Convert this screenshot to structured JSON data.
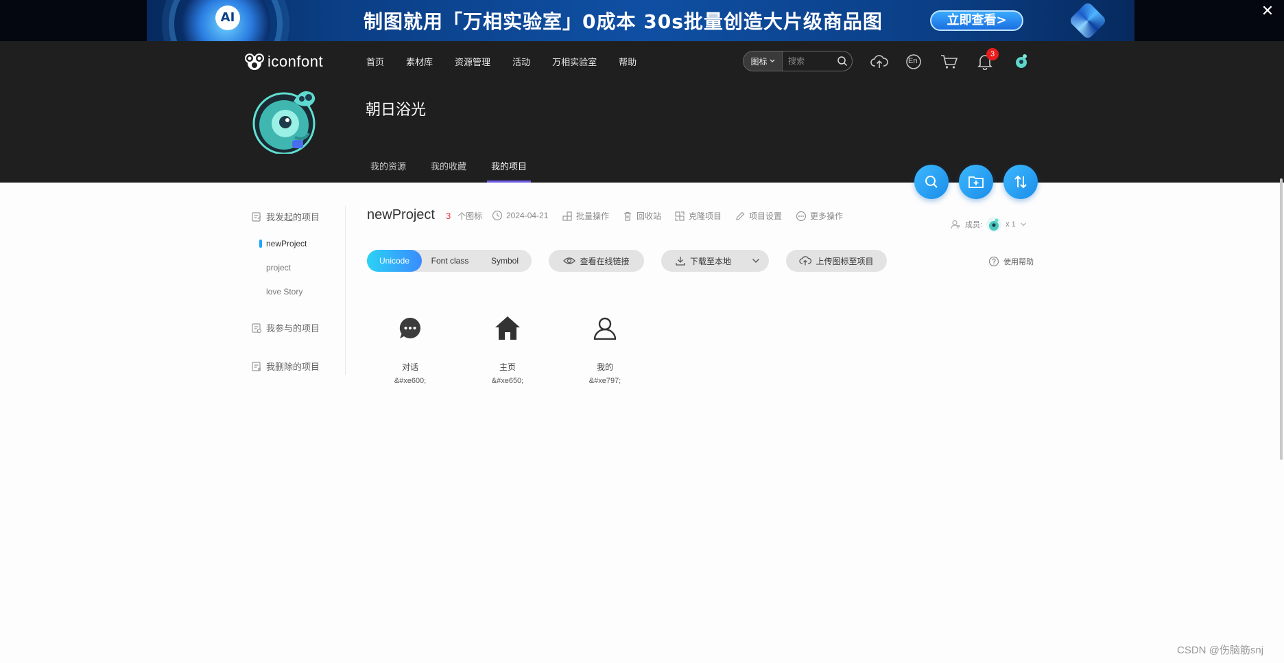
{
  "promo": {
    "ai_badge": "AI",
    "text": "制图就用「万相实验室」0成本 30s批量创造大片级商品图",
    "button": "立即查看>",
    "close": "✕"
  },
  "header": {
    "logo_text": "iconfont",
    "nav": [
      "首页",
      "素材库",
      "资源管理",
      "活动",
      "万相实验室",
      "帮助"
    ],
    "search": {
      "type_label": "图标",
      "placeholder": "搜索"
    },
    "language_label": "En",
    "notification_count": "3"
  },
  "profile": {
    "name": "朝日浴光",
    "tabs": [
      "我的资源",
      "我的收藏",
      "我的项目"
    ],
    "active_tab": "我的项目"
  },
  "sidebar": {
    "group_created": "我发起的项目",
    "projects": [
      "newProject",
      "project",
      "love Story"
    ],
    "active_project": "newProject",
    "group_joined": "我参与的项目",
    "group_deleted": "我删除的项目"
  },
  "project": {
    "name": "newProject",
    "icon_count": "3",
    "icon_count_label": "个图标",
    "date": "2024-04-21",
    "actions": {
      "batch": "批量操作",
      "recycle": "回收站",
      "clone": "克隆项目",
      "settings": "项目设置",
      "more": "更多操作"
    },
    "members_label": "成员:",
    "members_count": "x 1"
  },
  "toolbar": {
    "formats": [
      "Unicode",
      "Font class",
      "Symbol"
    ],
    "active_format": "Unicode",
    "view_online": "查看在线链接",
    "download": "下载至本地",
    "upload": "上传图标至项目",
    "help": "使用帮助"
  },
  "icons": [
    {
      "name": "对话",
      "code": "&#xe600;",
      "icon": "chat-bubble-icon"
    },
    {
      "name": "主页",
      "code": "&#xe650;",
      "icon": "home-icon"
    },
    {
      "name": "我的",
      "code": "&#xe797;",
      "icon": "user-icon"
    }
  ],
  "colors": {
    "header_bg": "#1f1f1f",
    "accent_blue": "#1a8de8",
    "tab_underline": "#6c5ce7",
    "count_red": "#e8403c",
    "badge_red": "#e81c1c"
  },
  "watermark": "CSDN @伤脑筋snj"
}
